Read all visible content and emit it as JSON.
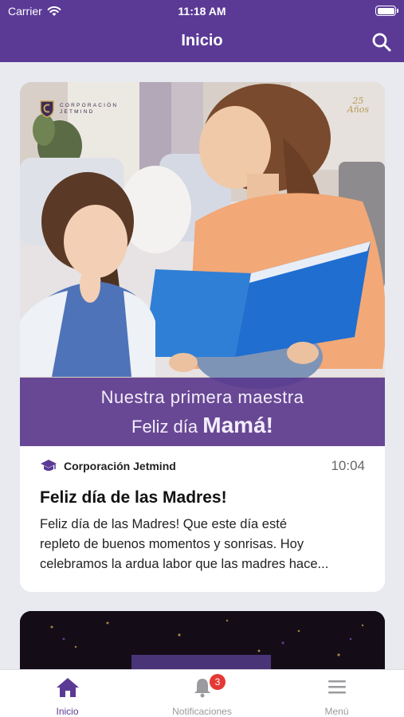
{
  "status_bar": {
    "carrier": "Carrier",
    "time": "11:18 AM"
  },
  "nav": {
    "title": "Inicio",
    "search_icon": "search-icon"
  },
  "feed": {
    "posts": [
      {
        "image": {
          "brand_line1": "Corporación",
          "brand_line2": "Jetmind",
          "anniversary_number": "25",
          "anniversary_word": "Años",
          "banner_line1": "Nuestra primera maestra",
          "banner_line2_prefix": "Feliz día",
          "banner_line2_emphasis": "Mamá!"
        },
        "organization": "Corporación Jetmind",
        "org_icon": "graduation-cap-icon",
        "time": "10:04",
        "title": "Feliz día de las Madres!",
        "body_lines": [
          "Feliz día de las Madres! Que este día esté",
          "repleto de buenos momentos y sonrisas. Hoy",
          "celebramos la ardua labor que las madres hace..."
        ]
      }
    ]
  },
  "tab_bar": {
    "tabs": [
      {
        "label": "Inicio",
        "icon": "home-icon",
        "active": true
      },
      {
        "label": "Notificaciones",
        "icon": "bell-icon",
        "badge": "3"
      },
      {
        "label": "Menú",
        "icon": "hamburger-menu-icon"
      }
    ]
  },
  "colors": {
    "brand": "#5b3a96",
    "badge": "#e53935",
    "background": "#e9eaf0"
  }
}
